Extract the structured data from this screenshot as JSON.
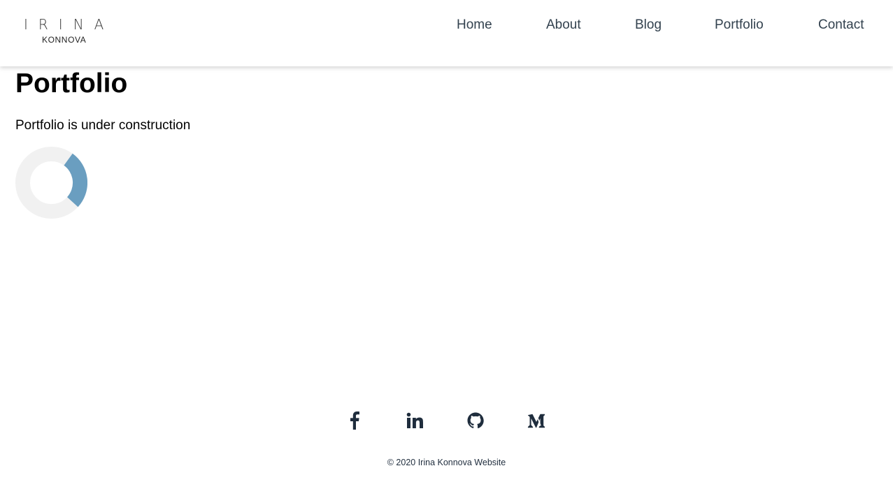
{
  "logo": {
    "top": "IRINA",
    "bottom": "KONNOVA"
  },
  "nav": {
    "items": [
      {
        "label": "Home"
      },
      {
        "label": "About"
      },
      {
        "label": "Blog"
      },
      {
        "label": "Portfolio"
      },
      {
        "label": "Contact"
      }
    ]
  },
  "main": {
    "title": "Portfolio",
    "text": "Portfolio is under construction"
  },
  "spinner": {
    "track_color": "#f1f1f1",
    "arc_color": "#6a9ec0"
  },
  "footer": {
    "social_icons": [
      "facebook-icon",
      "linkedin-icon",
      "github-icon",
      "medium-icon"
    ],
    "copyright": "© 2020 Irina Konnova Website"
  }
}
